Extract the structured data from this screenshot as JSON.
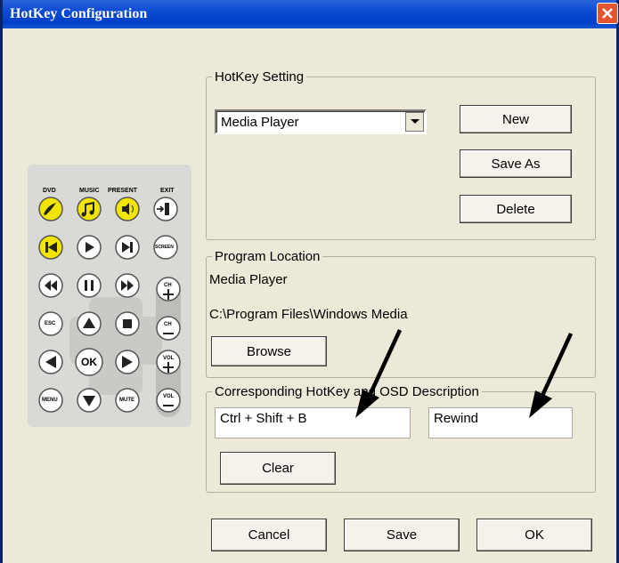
{
  "window": {
    "title": "HotKey Configuration"
  },
  "hotkey_setting": {
    "legend": "HotKey Setting",
    "profile_selected": "Media Player",
    "new_label": "New",
    "save_as_label": "Save As",
    "delete_label": "Delete"
  },
  "program_location": {
    "legend": "Program Location",
    "name": "Media Player",
    "path": "C:\\Program Files\\Windows Media",
    "browse_label": "Browse"
  },
  "hotkey_description": {
    "legend": "Corresponding HotKey and OSD Description",
    "hotkey_value": "Ctrl + Shift + B",
    "osd_value": "Rewind",
    "clear_label": "Clear"
  },
  "footer": {
    "cancel_label": "Cancel",
    "save_label": "Save",
    "ok_label": "OK"
  },
  "remote": {
    "labels": {
      "dvd": "DVD",
      "music": "MUSIC",
      "present": "PRESENT",
      "exit": "EXIT",
      "screen": "SCREEN",
      "ch_plus": "CH",
      "ch_minus": "CH",
      "esc": "ESC",
      "ok": "OK",
      "vol_plus": "VOL",
      "vol_minus": "VOL",
      "menu": "MENU",
      "mute": "MUTE"
    },
    "highlight_color": "#f2e600"
  },
  "annotations": {
    "arrow_color": "#000000"
  }
}
